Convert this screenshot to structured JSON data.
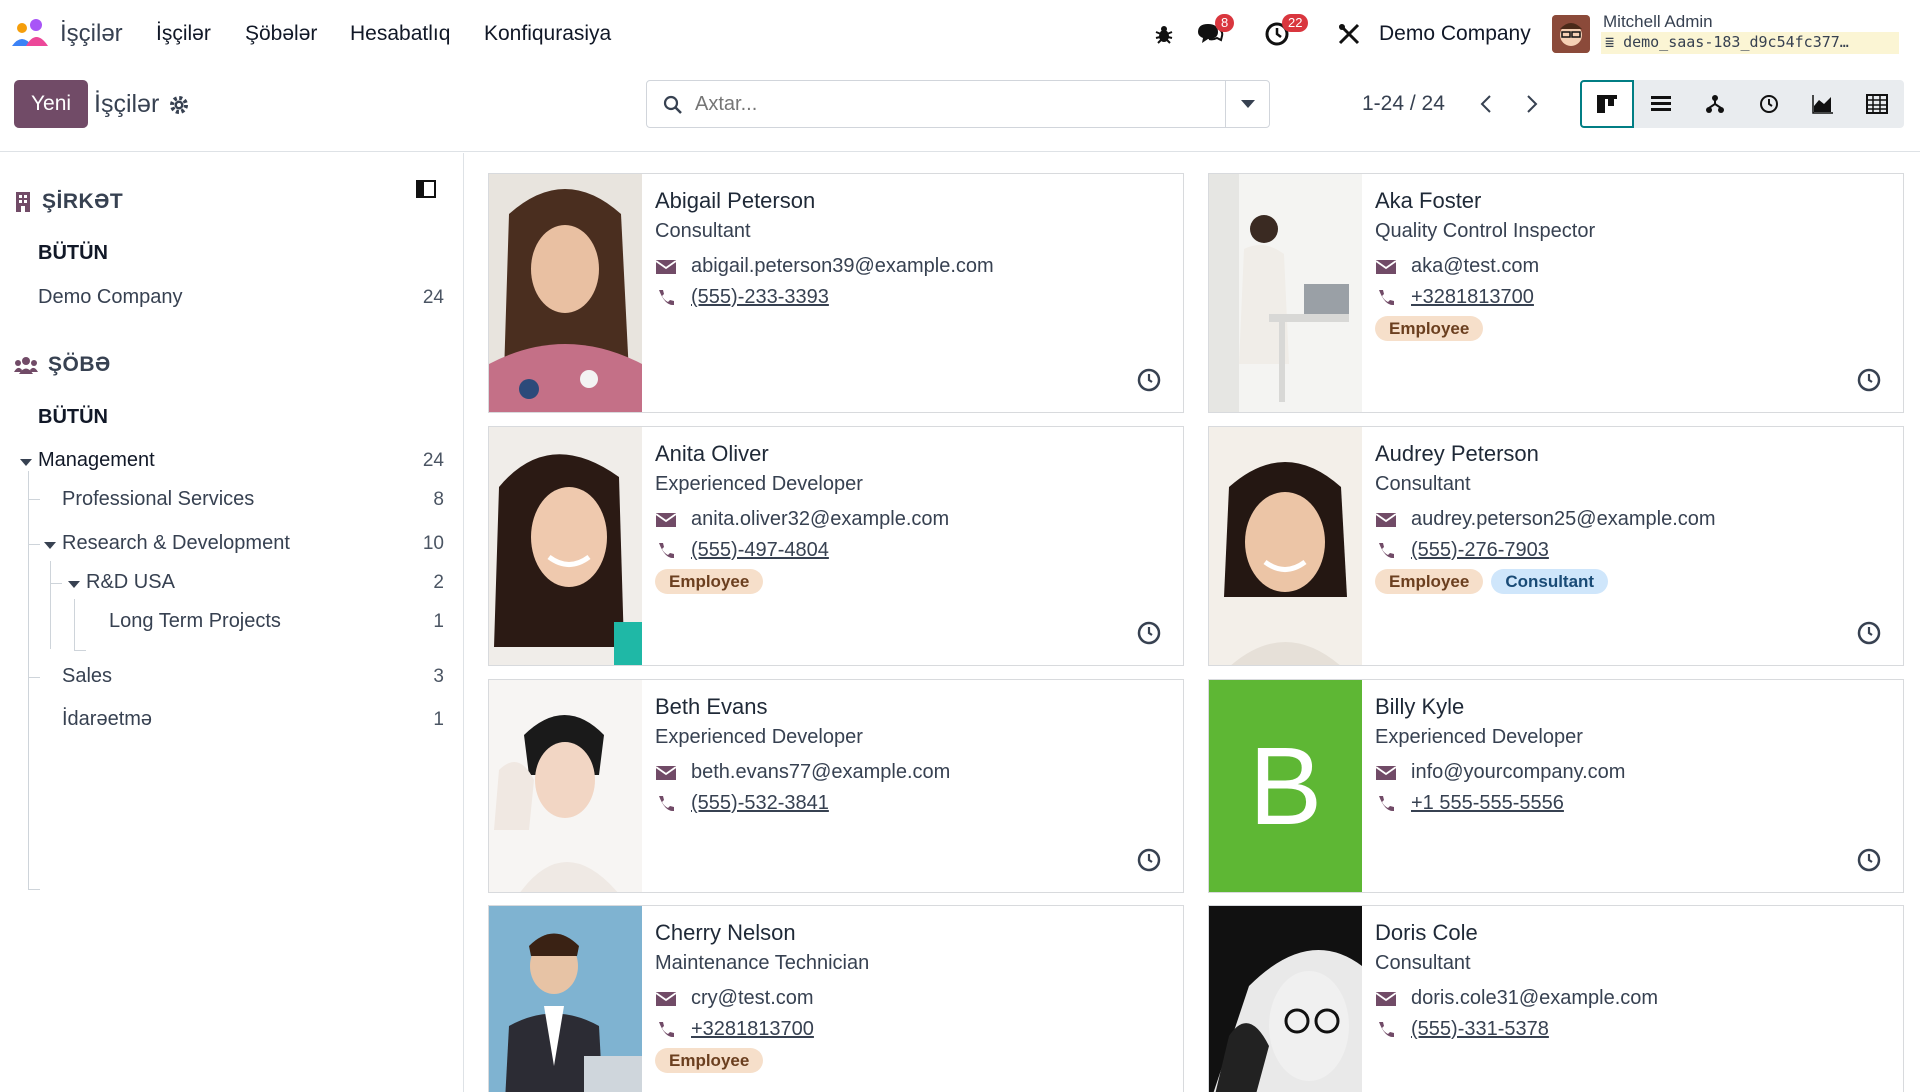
{
  "navbar": {
    "app_name": "İşçilər",
    "menu": [
      "İşçilər",
      "Şöbələr",
      "Hesabatlıq",
      "Konfiqurasiya"
    ],
    "messages_count": "8",
    "activities_count": "22",
    "company": "Demo Company",
    "user": "Mitchell Admin",
    "database": "demo_saas-183_d9c54fc377…"
  },
  "control_panel": {
    "new_label": "Yeni",
    "title": "İşçilər",
    "search_placeholder": "Axtar...",
    "pager": "1-24 / 24",
    "views": [
      "kanban",
      "list",
      "hierarchy",
      "activity",
      "graph",
      "pivot"
    ],
    "active_view": "kanban"
  },
  "sidebar": {
    "company_header": "ŞİRKƏT",
    "company_all": "BÜTÜN",
    "companies": [
      {
        "label": "Demo Company",
        "count": "24"
      }
    ],
    "department_header": "ŞÖBƏ",
    "department_all": "BÜTÜN",
    "departments": [
      {
        "label": "Management",
        "count": "24"
      },
      {
        "label": "Professional Services",
        "count": "8"
      },
      {
        "label": "Research & Development",
        "count": "10"
      },
      {
        "label": "R&D USA",
        "count": "2"
      },
      {
        "label": "Long Term Projects",
        "count": "1"
      },
      {
        "label": "Sales",
        "count": "3"
      },
      {
        "label": "İdarəetmə",
        "count": "1"
      }
    ]
  },
  "employees": [
    {
      "name": "Abigail Peterson",
      "job": "Consultant",
      "email": "abigail.peterson39@example.com",
      "phone": "(555)-233-3393",
      "tags": []
    },
    {
      "name": "Aka Foster",
      "job": "Quality Control Inspector",
      "email": "aka@test.com",
      "phone": "+3281813700",
      "tags": [
        "Employee"
      ]
    },
    {
      "name": "Anita Oliver",
      "job": "Experienced Developer",
      "email": "anita.oliver32@example.com",
      "phone": "(555)-497-4804",
      "tags": [
        "Employee"
      ]
    },
    {
      "name": "Audrey Peterson",
      "job": "Consultant",
      "email": "audrey.peterson25@example.com",
      "phone": "(555)-276-7903",
      "tags": [
        "Employee",
        "Consultant"
      ]
    },
    {
      "name": "Beth Evans",
      "job": "Experienced Developer",
      "email": "beth.evans77@example.com",
      "phone": "(555)-532-3841",
      "tags": []
    },
    {
      "name": "Billy Kyle",
      "job": "Experienced Developer",
      "email": "info@yourcompany.com",
      "phone": "+1 555-555-5556",
      "tags": [],
      "initial": "B"
    },
    {
      "name": "Cherry Nelson",
      "job": "Maintenance Technician",
      "email": "cry@test.com",
      "phone": "+3281813700",
      "tags": [
        "Employee"
      ]
    },
    {
      "name": "Doris Cole",
      "job": "Consultant",
      "email": "doris.cole31@example.com",
      "phone": "(555)-331-5378",
      "tags": []
    }
  ],
  "colors": {
    "brand": "#714b67",
    "active_view_border": "#017e84",
    "badge": "#d9363e"
  }
}
